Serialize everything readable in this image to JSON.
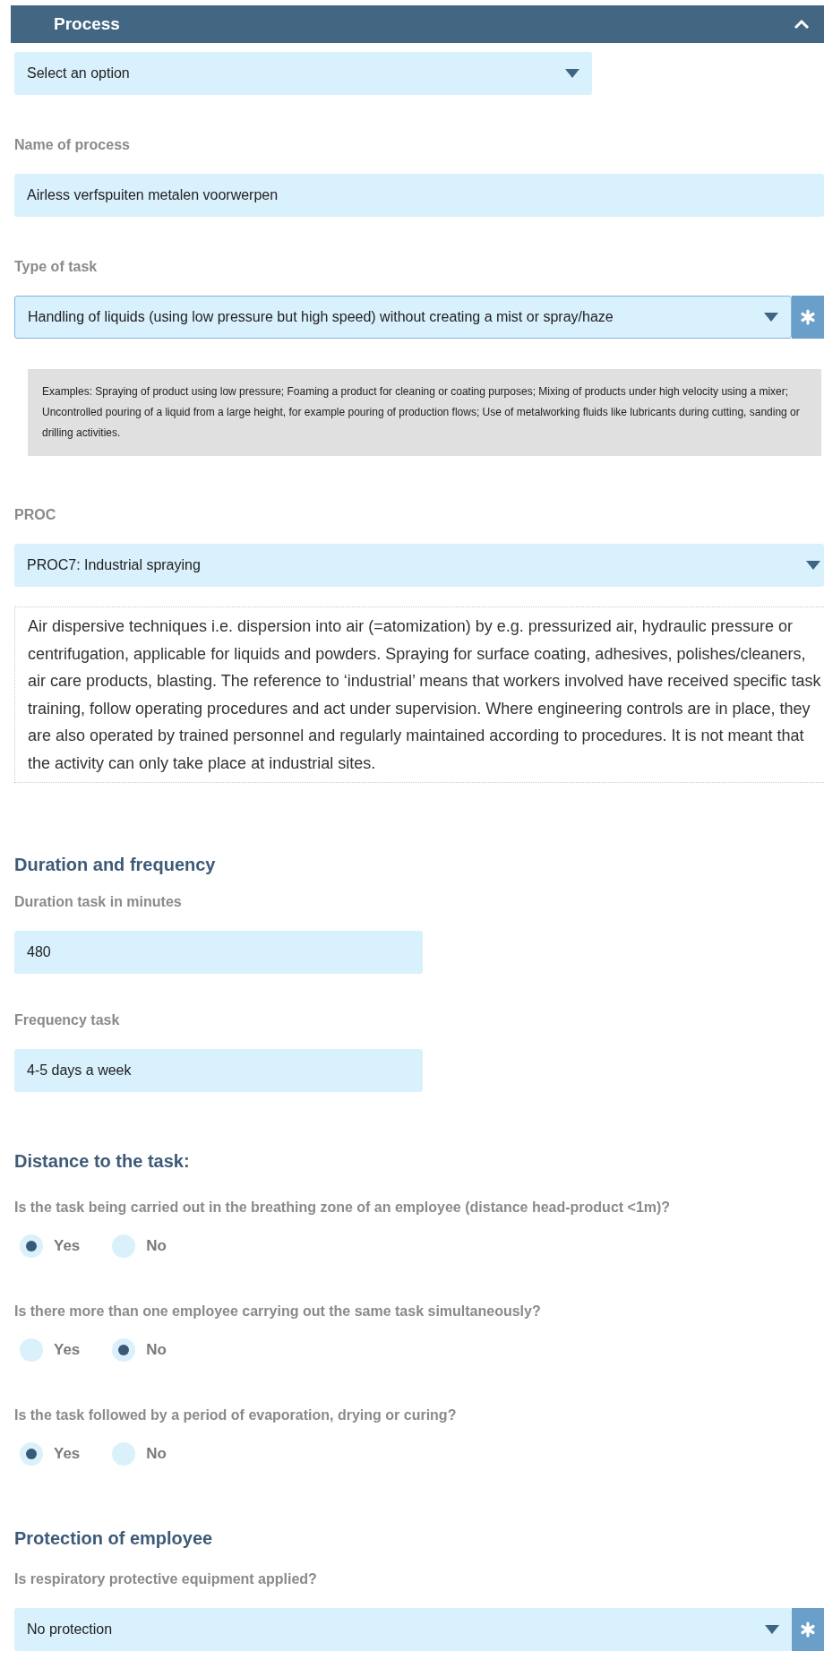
{
  "panel": {
    "title": "Process",
    "expanded": true
  },
  "preset": {
    "value": "Select an option"
  },
  "process_name": {
    "label": "Name of process",
    "value": "Airless verfspuiten metalen voorwerpen"
  },
  "task_type": {
    "label": "Type of task",
    "value": "Handling of liquids (using low pressure but high speed) without creating a mist or spray/haze",
    "focused": true,
    "required": true,
    "examples": "Examples: Spraying of product using low pressure; Foaming a product for cleaning or coating purposes; Mixing of products under high velocity using a mixer; Uncontrolled pouring of a liquid from a large height, for example pouring of production flows; Use of metalworking fluids like lubricants during cutting, sanding or drilling activities."
  },
  "proc": {
    "label": "PROC",
    "value": "PROC7: Industrial spraying",
    "description": "Air dispersive techniques i.e. dispersion into air (=atomization) by e.g. pressurized air, hydraulic pressure or centrifugation, applicable for liquids and powders. Spraying for surface coating, adhesives, polishes/cleaners, air care products, blasting. The reference to ‘industrial’ means that workers involved have received specific task training, follow operating procedures and act under supervision. Where engineering controls are in place, they are also operated by trained personnel and regularly maintained according to procedures. It is not meant that the activity can only take place at industrial sites."
  },
  "duration_frequency": {
    "heading": "Duration and frequency",
    "fields": [
      {
        "label": "Duration task in minutes",
        "value": "480"
      },
      {
        "label": "Frequency task",
        "value": "4-5 days a week"
      }
    ]
  },
  "distance": {
    "heading": "Distance to the task:",
    "questions": [
      {
        "text": "Is the task being carried out in the breathing zone of an employee (distance head-product <1m)?",
        "options": [
          {
            "label": "Yes",
            "selected": true
          },
          {
            "label": "No",
            "selected": false
          }
        ]
      },
      {
        "text": "Is there more than one employee carrying out the same task simultaneously?",
        "options": [
          {
            "label": "Yes",
            "selected": false
          },
          {
            "label": "No",
            "selected": true
          }
        ]
      },
      {
        "text": "Is the task followed by a period of evaporation, drying or curing?",
        "options": [
          {
            "label": "Yes",
            "selected": true
          },
          {
            "label": "No",
            "selected": false
          }
        ]
      }
    ]
  },
  "protection": {
    "heading": "Protection of employee",
    "label": "Is respiratory protective equipment applied?",
    "value": "No protection",
    "required": true
  }
}
